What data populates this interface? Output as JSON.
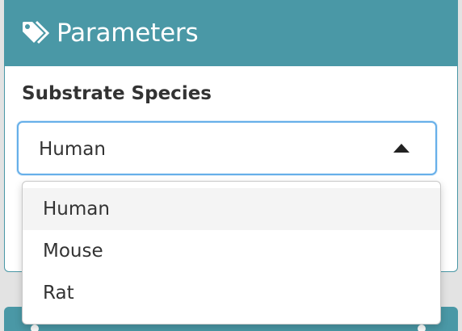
{
  "panel": {
    "title": "Parameters",
    "icon": "tags-icon",
    "header_color": "#4a98a6"
  },
  "field": {
    "label": "Substrate Species",
    "selected_value": "Human"
  },
  "dropdown": {
    "options": [
      "Human",
      "Mouse",
      "Rat"
    ],
    "highlighted_option": "Human"
  },
  "colors": {
    "accent": "#4a98a6",
    "focus_border": "#66afe9",
    "text": "#333333"
  }
}
